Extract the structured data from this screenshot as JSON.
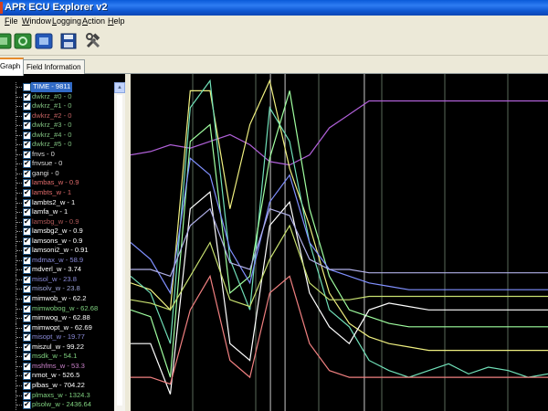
{
  "window": {
    "title": "APR ECU Explorer v2"
  },
  "menu": [
    "File",
    "Window",
    "Logging",
    "Action",
    "Help"
  ],
  "toolbar": {
    "buttons": [
      {
        "name": "open-log-icon",
        "color": "#2e8b34"
      },
      {
        "name": "connect-icon",
        "color": "#2e8b34"
      },
      {
        "name": "ecu-icon",
        "color": "#2559b8"
      },
      {
        "name": "save-icon",
        "color": "#1f4a9a"
      },
      {
        "name": "tools-icon",
        "color": "#444444"
      }
    ]
  },
  "tabs": [
    "Graph",
    "Field Information"
  ],
  "channels": [
    {
      "label": "TIME - 9811",
      "color": "#ffffff",
      "checked": false,
      "selected": true
    },
    {
      "label": "dwkrz_#0 - 0",
      "color": "#7fbf7f",
      "checked": true
    },
    {
      "label": "dwkrz_#1 - 0",
      "color": "#7fbf7f",
      "checked": true
    },
    {
      "label": "dwkrz_#2 - 0",
      "color": "#c06060",
      "checked": true
    },
    {
      "label": "dwkrz_#3 - 0",
      "color": "#7fbf7f",
      "checked": true
    },
    {
      "label": "dwkrz_#4 - 0",
      "color": "#7fbf7f",
      "checked": true
    },
    {
      "label": "dwkrz_#5 - 0",
      "color": "#7fbf7f",
      "checked": true
    },
    {
      "label": "fnvs - 0",
      "color": "#dddddd",
      "checked": true
    },
    {
      "label": "fnvsue - 0",
      "color": "#dddddd",
      "checked": true
    },
    {
      "label": "gangi - 0",
      "color": "#dddddd",
      "checked": true
    },
    {
      "label": "lambas_w - 0.9",
      "color": "#e06a6a",
      "checked": true
    },
    {
      "label": "lambts_w - 1",
      "color": "#e06a6a",
      "checked": true
    },
    {
      "label": "lambts2_w - 1",
      "color": "#ffffff",
      "checked": true
    },
    {
      "label": "lamfa_w - 1",
      "color": "#ffffff",
      "checked": true
    },
    {
      "label": "lamsbg_w - 0.9",
      "color": "#b05858",
      "checked": true
    },
    {
      "label": "lamsbg2_w - 0.9",
      "color": "#ffffff",
      "checked": true
    },
    {
      "label": "lamsons_w - 0.9",
      "color": "#ffffff",
      "checked": true
    },
    {
      "label": "lamsoni2_w - 0.91",
      "color": "#ffffff",
      "checked": true
    },
    {
      "label": "mdmax_w - 58.9",
      "color": "#8a8ad8",
      "checked": true
    },
    {
      "label": "mdverl_w - 3.74",
      "color": "#ffffff",
      "checked": true
    },
    {
      "label": "misol_w - 23.8",
      "color": "#8a8ad8",
      "checked": true
    },
    {
      "label": "misolv_w - 23.8",
      "color": "#9fa6d8",
      "checked": true
    },
    {
      "label": "mimwob_w - 62.2",
      "color": "#ffffff",
      "checked": true
    },
    {
      "label": "mimwobog_w - 62.68",
      "color": "#7fd07f",
      "checked": true
    },
    {
      "label": "mimwog_w - 62.88",
      "color": "#ffffff",
      "checked": true
    },
    {
      "label": "mimwopt_w - 62.69",
      "color": "#ffffff",
      "checked": true
    },
    {
      "label": "misopt_w - 19.77",
      "color": "#8a8ad8",
      "checked": true
    },
    {
      "label": "miszul_w - 99.22",
      "color": "#ffffff",
      "checked": true
    },
    {
      "label": "msdk_w - 54.1",
      "color": "#7fd07f",
      "checked": true
    },
    {
      "label": "mshfms_w - 53.3",
      "color": "#c880c8",
      "checked": true
    },
    {
      "label": "nmot_w - 526.5",
      "color": "#ffffff",
      "checked": true
    },
    {
      "label": "plbas_w - 704.22",
      "color": "#ffffff",
      "checked": true
    },
    {
      "label": "plmaxs_w - 1324.3",
      "color": "#7fd07f",
      "checked": true
    },
    {
      "label": "plsolw_w - 2436.64",
      "color": "#7fd07f",
      "checked": true
    }
  ],
  "chart_data": {
    "type": "line",
    "grid": true,
    "series": [
      {
        "color": "#b060d8",
        "values": [
          0.76,
          0.77,
          0.79,
          0.78,
          0.8,
          0.82,
          0.79,
          0.74,
          0.73,
          0.76,
          0.84,
          0.88,
          0.92,
          0.92,
          0.92,
          0.92,
          0.92,
          0.92,
          0.92,
          0.92,
          0.92,
          0.92
        ]
      },
      {
        "color": "#f0f080",
        "values": [
          0.38,
          0.36,
          0.3,
          0.95,
          0.95,
          0.6,
          0.85,
          0.98,
          0.72,
          0.55,
          0.35,
          0.26,
          0.22,
          0.2,
          0.19,
          0.18,
          0.18,
          0.18,
          0.18,
          0.18,
          0.18,
          0.18
        ]
      },
      {
        "color": "#70e0b8",
        "values": [
          0.4,
          0.35,
          0.2,
          0.9,
          0.98,
          0.45,
          0.3,
          0.9,
          0.8,
          0.5,
          0.3,
          0.25,
          0.15,
          0.12,
          0.1,
          0.12,
          0.14,
          0.11,
          0.13,
          0.12,
          0.1,
          0.11
        ]
      },
      {
        "color": "#a0ffa0",
        "values": [
          0.3,
          0.28,
          0.1,
          0.8,
          0.85,
          0.35,
          0.4,
          0.75,
          0.95,
          0.6,
          0.4,
          0.3,
          0.28,
          0.26,
          0.25,
          0.25,
          0.25,
          0.25,
          0.25,
          0.25,
          0.25,
          0.25
        ]
      },
      {
        "color": "#8090ff",
        "values": [
          0.5,
          0.45,
          0.35,
          0.75,
          0.7,
          0.48,
          0.38,
          0.62,
          0.7,
          0.5,
          0.42,
          0.4,
          0.38,
          0.37,
          0.36,
          0.36,
          0.36,
          0.36,
          0.36,
          0.36,
          0.36,
          0.36
        ]
      },
      {
        "color": "#ffffff",
        "values": [
          0.2,
          0.2,
          0.05,
          0.6,
          0.65,
          0.2,
          0.15,
          0.55,
          0.62,
          0.35,
          0.25,
          0.2,
          0.3,
          0.32,
          0.31,
          0.3,
          0.3,
          0.3,
          0.3,
          0.3,
          0.3,
          0.3
        ]
      },
      {
        "color": "#f08080",
        "values": [
          0.1,
          0.1,
          0.08,
          0.3,
          0.4,
          0.15,
          0.1,
          0.35,
          0.4,
          0.2,
          0.12,
          0.1,
          0.1,
          0.1,
          0.1,
          0.1,
          0.1,
          0.1,
          0.1,
          0.1,
          0.1,
          0.1
        ]
      },
      {
        "color": "#b0b0e8",
        "values": [
          0.42,
          0.42,
          0.4,
          0.55,
          0.6,
          0.44,
          0.42,
          0.6,
          0.58,
          0.45,
          0.42,
          0.42,
          0.41,
          0.41,
          0.41,
          0.41,
          0.41,
          0.41,
          0.41,
          0.41,
          0.41,
          0.41
        ]
      },
      {
        "color": "#c8e070",
        "values": [
          0.33,
          0.32,
          0.3,
          0.4,
          0.5,
          0.33,
          0.31,
          0.45,
          0.55,
          0.38,
          0.33,
          0.33,
          0.34,
          0.34,
          0.34,
          0.34,
          0.34,
          0.34,
          0.34,
          0.34,
          0.34,
          0.34
        ]
      }
    ],
    "vertical_markers": [
      0.335,
      0.37,
      0.56
    ]
  }
}
